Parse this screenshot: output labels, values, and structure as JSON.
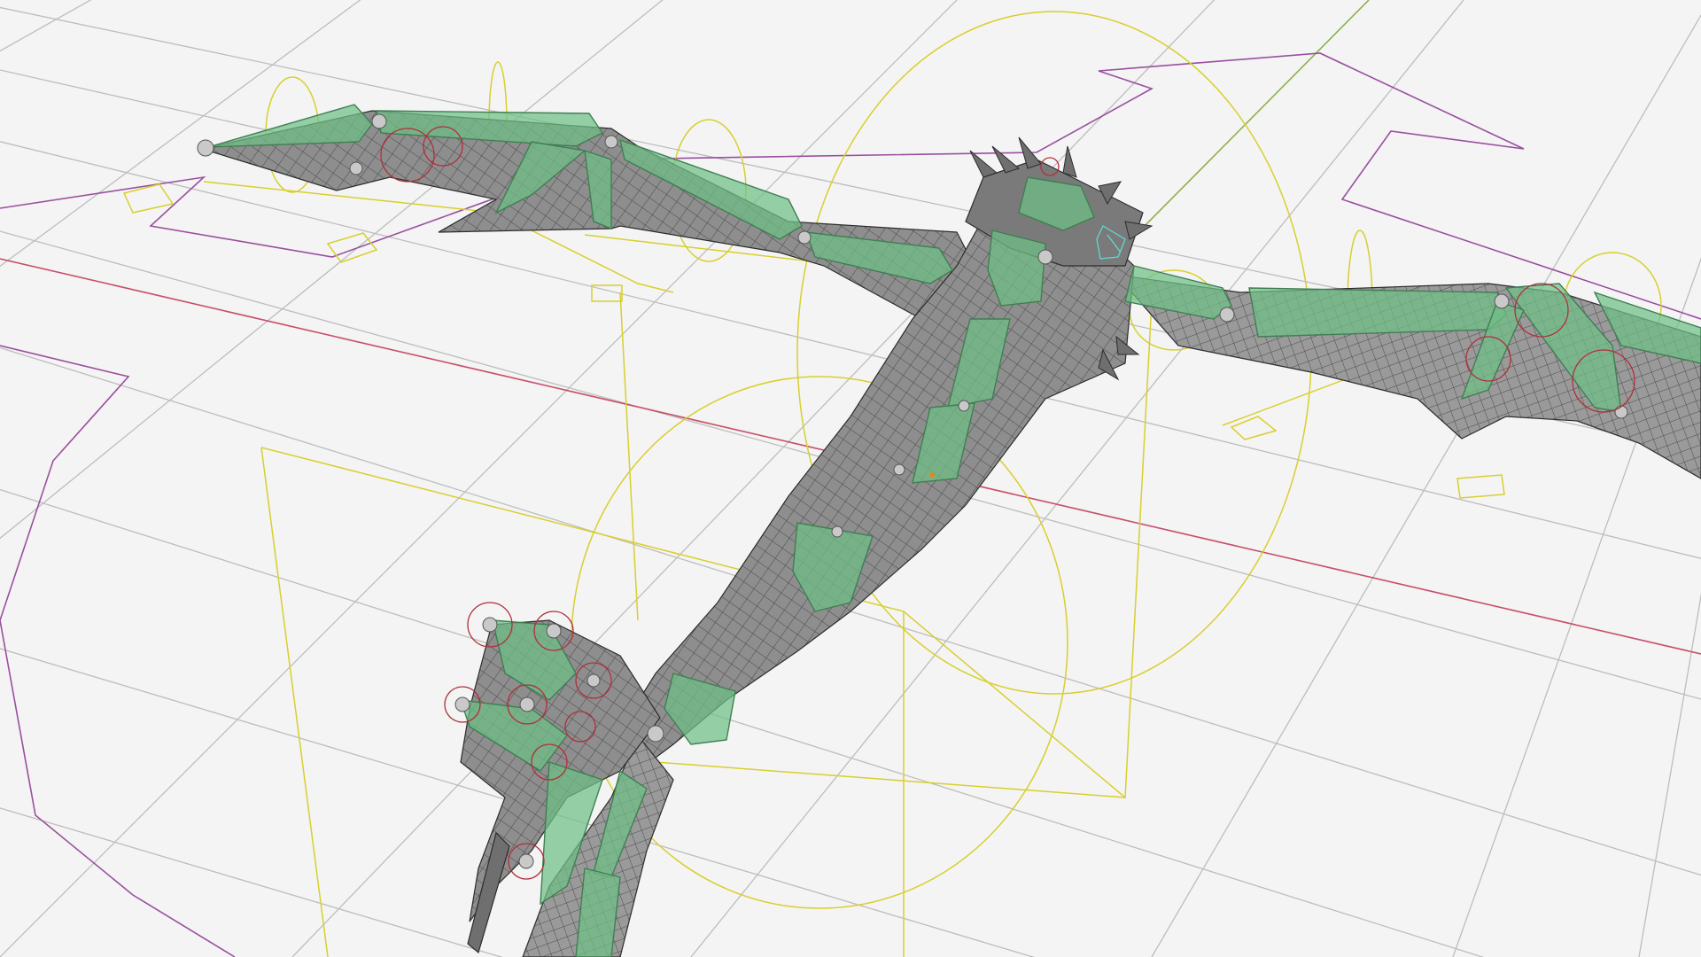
{
  "viewport": {
    "mode": "3d-viewport-wireframe-overlay",
    "subject": "dragon-armature-rig"
  },
  "colors": {
    "background": "#f4f4f4",
    "grid": "#bdbdbd",
    "x_axis": "#c8506a",
    "y_axis": "#8bb04e",
    "mesh_fill": "#8e8e8e",
    "mesh_wire": "#2f2f2f",
    "bone_fill": "#6fbf87",
    "bone_stroke": "#3f7f52",
    "control_yellow": "#d8cf2e",
    "control_purple": "#9a4f9f",
    "control_red": "#b0303a",
    "selection_cyan": "#5fd8d0"
  },
  "icons": {
    "origin": "origin-dot-icon"
  }
}
